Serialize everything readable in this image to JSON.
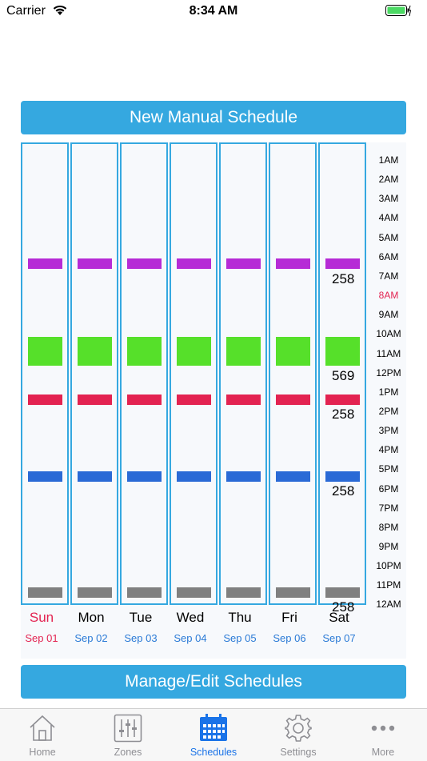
{
  "status": {
    "carrier": "Carrier",
    "time": "8:34 AM"
  },
  "buttons": {
    "new_manual": "New Manual Schedule",
    "manage_edit": "Manage/Edit Schedules"
  },
  "colors": {
    "accent": "#35a8e0",
    "magenta": "#b62bd6",
    "green": "#56e02a",
    "red": "#e32351",
    "blue": "#2a6ad6",
    "gray": "#808080"
  },
  "days": [
    {
      "name": "Sun",
      "date": "Sep 01"
    },
    {
      "name": "Mon",
      "date": "Sep 02"
    },
    {
      "name": "Tue",
      "date": "Sep 03"
    },
    {
      "name": "Wed",
      "date": "Sep 04"
    },
    {
      "name": "Thu",
      "date": "Sep 05"
    },
    {
      "name": "Fri",
      "date": "Sep 06"
    },
    {
      "name": "Sat",
      "date": "Sep 07"
    }
  ],
  "hours": [
    "1AM",
    "2AM",
    "3AM",
    "4AM",
    "5AM",
    "6AM",
    "7AM",
    "8AM",
    "9AM",
    "10AM",
    "11AM",
    "12PM",
    "1PM",
    "2PM",
    "3PM",
    "4PM",
    "5PM",
    "6PM",
    "7PM",
    "8PM",
    "9PM",
    "10PM",
    "11PM",
    "12AM"
  ],
  "current_hour": "8AM",
  "zone_labels": {
    "magenta": "258",
    "green": "569",
    "red": "258",
    "blue": "258",
    "gray": "258"
  },
  "tabs": [
    {
      "label": "Home",
      "icon": "home-icon"
    },
    {
      "label": "Zones",
      "icon": "sliders-icon"
    },
    {
      "label": "Schedules",
      "icon": "calendar-icon",
      "active": true
    },
    {
      "label": "Settings",
      "icon": "gear-icon"
    },
    {
      "label": "More",
      "icon": "more-icon"
    }
  ]
}
